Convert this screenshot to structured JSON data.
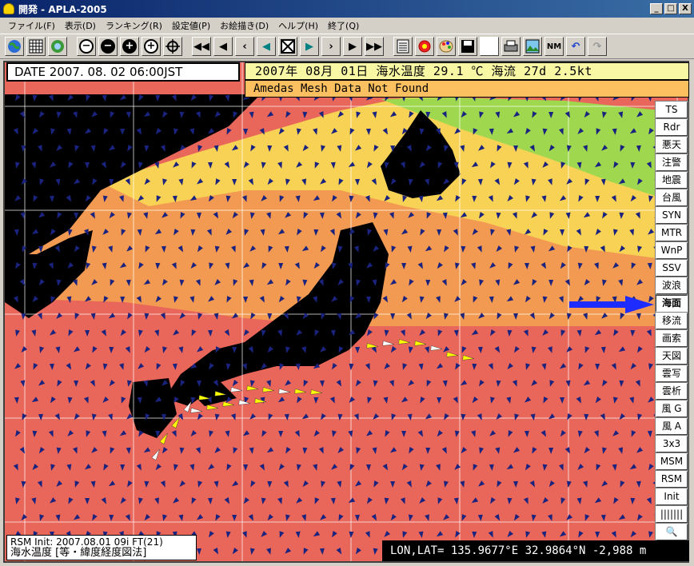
{
  "window": {
    "title": "開発 - APLA-2005",
    "minimize": "_",
    "maximize": "□",
    "close": "X"
  },
  "menu": [
    "ファイル(F)",
    "表示(D)",
    "ランキング(R)",
    "設定値(P)",
    "お絵描き(D)",
    "ヘルプ(H)",
    "終了(Q)"
  ],
  "toolbar": {
    "icons": [
      "globe-icon",
      "grid-icon",
      "web-icon",
      "zoom-out-icon",
      "minus-icon",
      "plus-icon",
      "add-icon",
      "center-icon",
      "first-icon",
      "prev-fast-icon",
      "prev-icon",
      "step-back-icon",
      "stop-icon",
      "step-forward-icon",
      "next-icon",
      "next-fast-icon",
      "last-icon",
      "list-icon",
      "settings-icon",
      "palette-icon",
      "save-icon",
      "blank-icon",
      "print-icon",
      "image-icon",
      "nm-icon",
      "undo-icon",
      "redo-icon"
    ],
    "nm_label": "NM"
  },
  "header": {
    "date_text": "DATE 2007. 08. 02  06:00JST",
    "info_text": "2007年 08月 01日  海水温度 29.1 ℃  海流 27d 2.5kt",
    "amedas_text": "Amedas Mesh Data Not Found"
  },
  "side_buttons": [
    {
      "label": "TS",
      "active": false
    },
    {
      "label": "Rdr",
      "active": false
    },
    {
      "label": "悪天",
      "active": false
    },
    {
      "label": "注警",
      "active": false
    },
    {
      "label": "地震",
      "active": false
    },
    {
      "label": "台風",
      "active": false
    },
    {
      "label": "SYN",
      "active": false
    },
    {
      "label": "MTR",
      "active": false
    },
    {
      "label": "WnP",
      "active": false
    },
    {
      "label": "SSV",
      "active": false
    },
    {
      "label": "波浪",
      "active": false
    },
    {
      "label": "海面",
      "active": true
    },
    {
      "label": "移流",
      "active": false
    },
    {
      "label": "画索",
      "active": false
    },
    {
      "label": "天図",
      "active": false
    },
    {
      "label": "雲写",
      "active": false
    },
    {
      "label": "雲析",
      "active": false
    },
    {
      "label": "風 G",
      "active": false
    },
    {
      "label": "風 A",
      "active": false
    },
    {
      "label": "3x3",
      "active": false
    },
    {
      "label": "MSM",
      "active": false
    },
    {
      "label": "RSM",
      "active": false
    },
    {
      "label": "Init",
      "active": false
    },
    {
      "label": "|||||||",
      "active": false
    },
    {
      "label": "🔍",
      "active": false
    }
  ],
  "footer": {
    "init_text": "RSM Init: 2007.08.01 09i FT(21)",
    "projection_text": "海水温度  [等・緯度経度図法]",
    "coord_text": "LON,LAT= 135.9677°E  32.9864°N  -2,988 m"
  },
  "colors": {
    "warm": "#e8665a",
    "mid": "#f39a52",
    "cool": "#f8d254",
    "cold": "#9fd84e",
    "land": "#000000",
    "arrow": "#1a237e",
    "current_strong": "#ffff00",
    "current_white": "#ffffff"
  }
}
